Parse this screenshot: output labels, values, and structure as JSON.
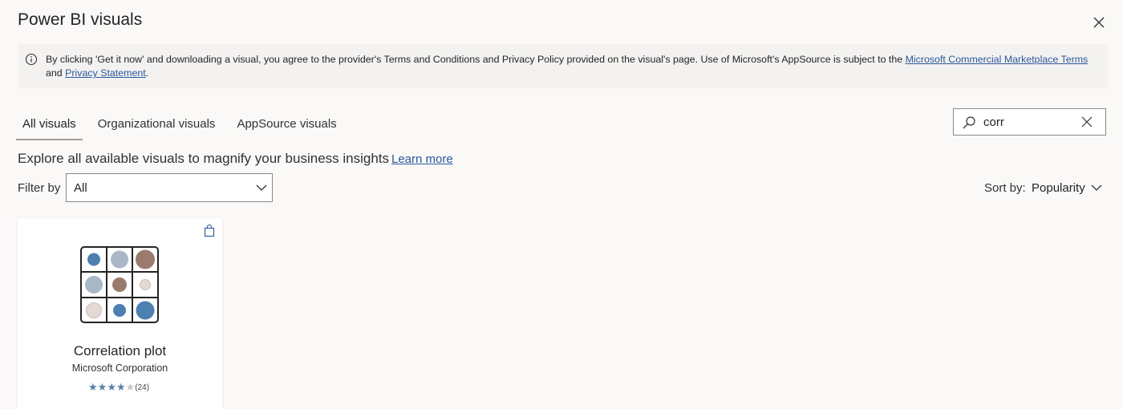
{
  "dialog": {
    "title": "Power BI visuals"
  },
  "banner": {
    "text": "By clicking 'Get it now' and downloading a visual, you agree to the provider's Terms and Conditions and Privacy Policy provided on the visual's page. Use of Microsoft's AppSource is subject to the ",
    "link1": "Microsoft Commercial Marketplace Terms",
    "and": " and ",
    "link2": "Privacy Statement",
    "end": "."
  },
  "tabs": [
    {
      "label": "All visuals",
      "active": true
    },
    {
      "label": "Organizational visuals",
      "active": false
    },
    {
      "label": "AppSource visuals",
      "active": false
    }
  ],
  "search": {
    "value": "corr"
  },
  "explore": {
    "text": "Explore all available visuals to magnify your business insights",
    "learn_more": "Learn more"
  },
  "filter": {
    "label": "Filter by",
    "value": "All"
  },
  "sort": {
    "label": "Sort by:",
    "value": "Popularity"
  },
  "cards": [
    {
      "name": "Correlation plot",
      "publisher": "Microsoft Corporation",
      "rating": 4,
      "max_rating": 5,
      "reviews": "(24)"
    }
  ],
  "colors": {
    "accent": "#2b579a",
    "star_filled": "#5b7ea6",
    "star_empty": "#c8c6c4"
  }
}
